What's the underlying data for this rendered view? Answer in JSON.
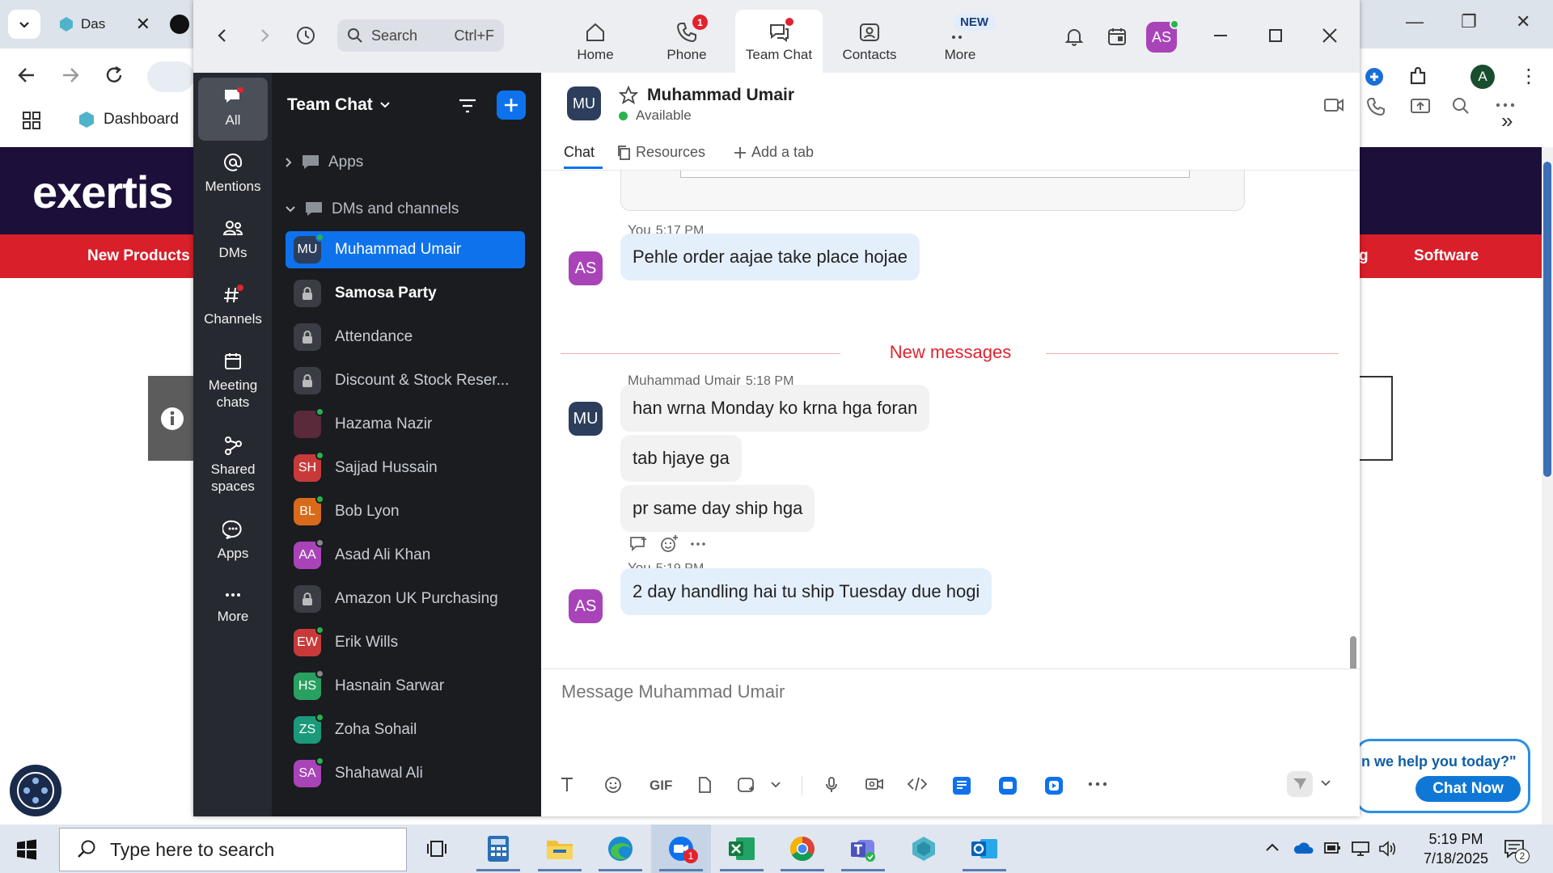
{
  "browser": {
    "tab_title": "Das",
    "bookmark": "Dashboard"
  },
  "website": {
    "logo": "exertis",
    "nav_left": "New Products",
    "nav_partial": "g",
    "nav_right": "Software",
    "chat_question": "n we help you today?\"",
    "chat_button": "Chat Now"
  },
  "zoom": {
    "search": {
      "label": "Search",
      "shortcut": "Ctrl+F"
    },
    "tabs": [
      {
        "label": "Home",
        "badge": ""
      },
      {
        "label": "Phone",
        "badge": "1"
      },
      {
        "label": "Team Chat",
        "badge": ""
      },
      {
        "label": "Contacts",
        "badge": ""
      },
      {
        "label": "More",
        "badge": "NEW"
      }
    ],
    "user_initials": "AS",
    "rail": [
      {
        "label": "All"
      },
      {
        "label": "Mentions"
      },
      {
        "label": "DMs"
      },
      {
        "label": "Channels"
      },
      {
        "label": "Meeting chats"
      },
      {
        "label": "Shared spaces"
      },
      {
        "label": "Apps"
      },
      {
        "label": "More"
      }
    ],
    "list": {
      "title": "Team Chat",
      "sections": [
        "Apps",
        "DMs and channels"
      ],
      "rows": [
        {
          "initials": "MU",
          "name": "Muhammad Umair",
          "color": "#2c3e5c",
          "presence": "#28b44a",
          "type": "dm"
        },
        {
          "initials": "",
          "name": "Samosa Party",
          "color": "#3a3d44",
          "presence": "",
          "type": "lock"
        },
        {
          "initials": "",
          "name": "Attendance",
          "color": "#3a3d44",
          "presence": "",
          "type": "lock"
        },
        {
          "initials": "",
          "name": "Discount & Stock Reser...",
          "color": "#3a3d44",
          "presence": "",
          "type": "lock"
        },
        {
          "initials": "",
          "name": "Hazama Nazir",
          "color": "#5a2a3a",
          "presence": "#28b44a",
          "type": "photo"
        },
        {
          "initials": "SH",
          "name": "Sajjad Hussain",
          "color": "#c83a3a",
          "presence": "#28b44a",
          "type": "dm"
        },
        {
          "initials": "BL",
          "name": "Bob Lyon",
          "color": "#d86a1a",
          "presence": "#28b44a",
          "type": "dm"
        },
        {
          "initials": "AA",
          "name": "Asad Ali Khan",
          "color": "#a844b8",
          "presence": "#888888",
          "type": "dm"
        },
        {
          "initials": "",
          "name": "Amazon UK Purchasing",
          "color": "#3a3d44",
          "presence": "",
          "type": "lock"
        },
        {
          "initials": "EW",
          "name": "Erik Wills",
          "color": "#c83a3a",
          "presence": "#28b44a",
          "type": "dm"
        },
        {
          "initials": "HS",
          "name": "Hasnain Sarwar",
          "color": "#28a060",
          "presence": "#888888",
          "type": "dm"
        },
        {
          "initials": "ZS",
          "name": "Zoha Sohail",
          "color": "#1a9a7a",
          "presence": "#28b44a",
          "type": "dm"
        },
        {
          "initials": "SA",
          "name": "Shahawal Ali",
          "color": "#a844b8",
          "presence": "#28b44a",
          "type": "dm"
        }
      ]
    },
    "chat": {
      "initials": "MU",
      "name": "Muhammad Umair",
      "status": "Available",
      "tabs": [
        "Chat",
        "Resources",
        "Add a tab"
      ],
      "new_messages_label": "New messages",
      "messages": [
        {
          "sender": "You",
          "time": "5:17 PM",
          "initials": "AS",
          "mine": true,
          "texts": [
            "Pehle order aajae take place hojae"
          ]
        },
        {
          "sender": "Muhammad Umair",
          "time": "5:18 PM",
          "initials": "MU",
          "mine": false,
          "texts": [
            "han wrna Monday ko krna hga foran",
            "tab hjaye ga",
            "pr same day ship hga"
          ]
        },
        {
          "sender": "You",
          "time": "5:19 PM",
          "initials": "AS",
          "mine": true,
          "texts": [
            "2 day handling hai tu ship Tuesday due hogi"
          ]
        }
      ],
      "compose_placeholder": "Message Muhammad Umair",
      "gif_label": "GIF"
    }
  },
  "taskbar": {
    "search_placeholder": "Type here to search",
    "time": "5:19 PM",
    "date": "7/18/2025",
    "zoom_badge": "1",
    "notif_count": "2"
  },
  "colors": {
    "zoom_blue": "#0e72ed",
    "site_red": "#d81f2a",
    "site_navy": "#1c0f3a",
    "presence_green": "#28b44a"
  }
}
